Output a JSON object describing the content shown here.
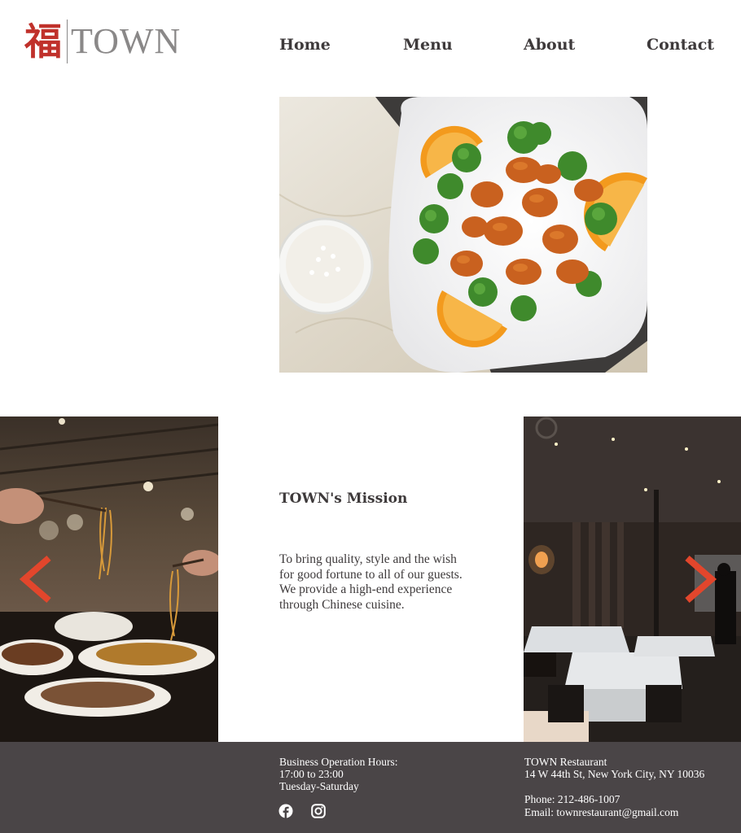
{
  "brand": {
    "logo_char": "福",
    "logo_word": "TOWN",
    "accent_color": "#c0312b"
  },
  "nav": {
    "items": [
      {
        "label": "Home"
      },
      {
        "label": "Menu"
      },
      {
        "label": "About"
      },
      {
        "label": "Contact"
      }
    ]
  },
  "hero": {
    "image": "orange-chicken-dish-photo"
  },
  "carousel": {
    "left_image": "diners-with-noodles-photo",
    "right_image": "restaurant-dining-room-photo",
    "prev_icon": "chevron-left-icon",
    "next_icon": "chevron-right-icon",
    "arrow_color": "#e2462c"
  },
  "mission": {
    "title": "TOWN's Mission",
    "lines": [
      "To bring quality, style and the wish",
      "for good fortune to all of our guests.",
      "We provide a high-end experience",
      "through Chinese cuisine."
    ]
  },
  "footer": {
    "background": "#4a4547",
    "hours_label": "Business Operation Hours:",
    "hours_time": "17:00 to 23:00",
    "hours_days": "Tuesday-Saturday",
    "social": [
      "facebook-icon",
      "instagram-icon"
    ],
    "name": "TOWN Restaurant",
    "address": "14 W 44th St, New York City, NY 10036",
    "phone": "Phone: 212-486-1007",
    "email": "Email: townrestaurant@gmail.com"
  }
}
